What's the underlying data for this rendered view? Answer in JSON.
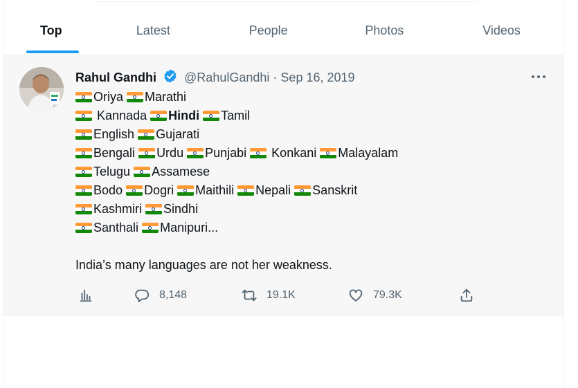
{
  "tabs": [
    {
      "label": "Top",
      "active": true
    },
    {
      "label": "Latest",
      "active": false
    },
    {
      "label": "People",
      "active": false
    },
    {
      "label": "Photos",
      "active": false
    },
    {
      "label": "Videos",
      "active": false
    }
  ],
  "tweet": {
    "author_name": "Rahul Gandhi",
    "handle": "@RahulGandhi",
    "separator": "·",
    "date": "Sep 16, 2019",
    "languages": {
      "l1": [
        "Oriya",
        "Marathi"
      ],
      "l2": [
        "Kannada",
        "Hindi",
        "Tamil"
      ],
      "l3": [
        "English",
        "Gujarati"
      ],
      "l4": [
        "Bengali",
        "Urdu",
        "Punjabi",
        "Konkani",
        "Malayalam"
      ],
      "l5": [
        "Telugu",
        "Assamese"
      ],
      "l6": [
        "Bodo",
        "Dogri",
        "Maithili",
        "Nepali",
        "Sanskrit"
      ],
      "l7": [
        "Kashmiri",
        "Sindhi"
      ],
      "l8": [
        "Santhali",
        "Manipuri..."
      ]
    },
    "closing_text": "India’s many languages are not her weakness.",
    "stats": {
      "replies": "8,148",
      "retweets": "19.1K",
      "likes": "79.3K"
    }
  },
  "icons": [
    "analytics-icon",
    "reply-icon",
    "retweet-icon",
    "like-icon",
    "share-icon",
    "verified-badge-icon",
    "more-icon",
    "india-flag-icon"
  ],
  "colors": {
    "accent": "#1d9bf0",
    "text": "#0f1419",
    "muted": "#536471",
    "flag_saffron": "#ff9933",
    "flag_green": "#138808"
  }
}
